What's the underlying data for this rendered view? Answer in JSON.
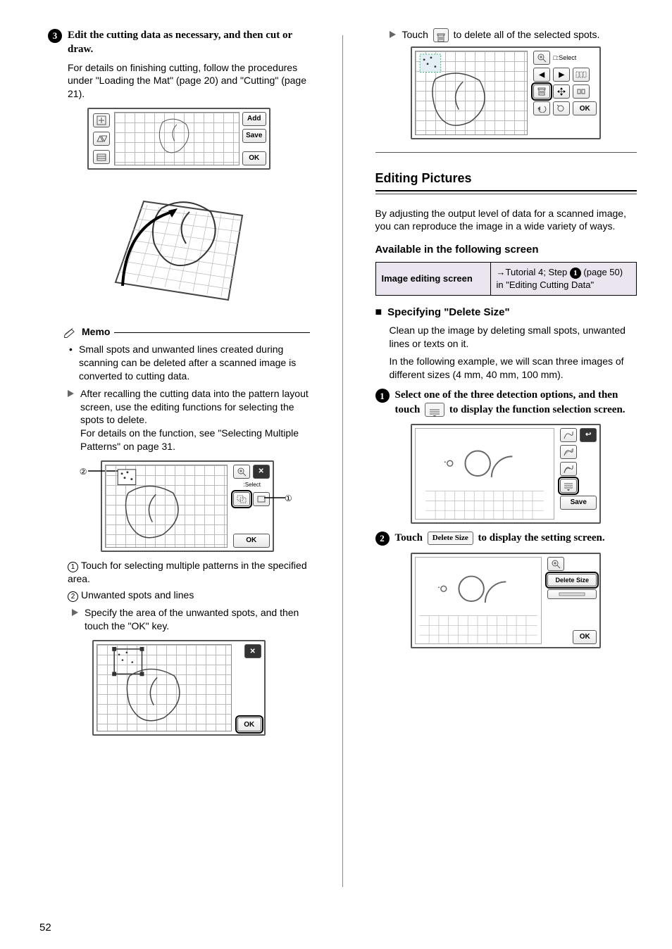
{
  "left": {
    "step3": {
      "num": "3",
      "title": "Edit the cutting data as necessary, and then cut or draw.",
      "para": "For details on finishing cutting, follow the procedures under \"Loading the Mat\" (page 20) and \"Cutting\" (page 21)."
    },
    "screen1": {
      "add": "Add",
      "save": "Save",
      "ok": "OK"
    },
    "memo": {
      "heading": "Memo",
      "b1": "Small spots and unwanted lines created during scanning can be deleted after a scanned image is converted to cutting data.",
      "t1": "After recalling the cutting data into the pattern layout screen, use the editing functions for selecting the spots to delete.",
      "t1b": "For details on the function, see \"Selecting Multiple Patterns\" on page 31."
    },
    "annot": {
      "l1": "Touch for selecting multiple patterns in the specified area.",
      "l2": "Unwanted spots and lines",
      "t1": "Specify the area of the unwanted spots, and then touch the \"OK\" key."
    },
    "screen3": {
      "ok": "OK",
      "select": ":Select"
    },
    "screen4": {
      "ok": "OK"
    }
  },
  "right": {
    "touch_trash": {
      "pre": "Touch ",
      "post": " to delete all of the selected spots."
    },
    "screen5": {
      "select": ":Select",
      "ok": "OK"
    },
    "section": "Editing Pictures",
    "intro": "By adjusting the output level of data for a scanned image, you can reproduce the image in a wide variety of ways.",
    "avail_h": "Available in the following screen",
    "table": {
      "c1": "Image editing screen",
      "c2a": "→Tutorial 4; Step ",
      "c2n": "1",
      "c2b": " (page 50) in \"Editing Cutting Data\""
    },
    "spec_h": "Specifying \"Delete Size\"",
    "spec_p1": "Clean up the image by deleting small spots, unwanted lines or texts on it.",
    "spec_p2": "In the following example, we will scan three images of different sizes (4 mm, 40 mm, 100 mm).",
    "step1": {
      "num": "1",
      "t1": "Select one of the three detection options, and then touch ",
      "t2": " to display the function selection screen."
    },
    "screen6": {
      "save": "Save"
    },
    "step2": {
      "num": "2",
      "t1": "Touch ",
      "btn": "Delete Size",
      "t2": " to display the setting screen."
    },
    "screen7": {
      "ds": "Delete Size",
      "ok": "OK"
    }
  },
  "page_number": "52"
}
